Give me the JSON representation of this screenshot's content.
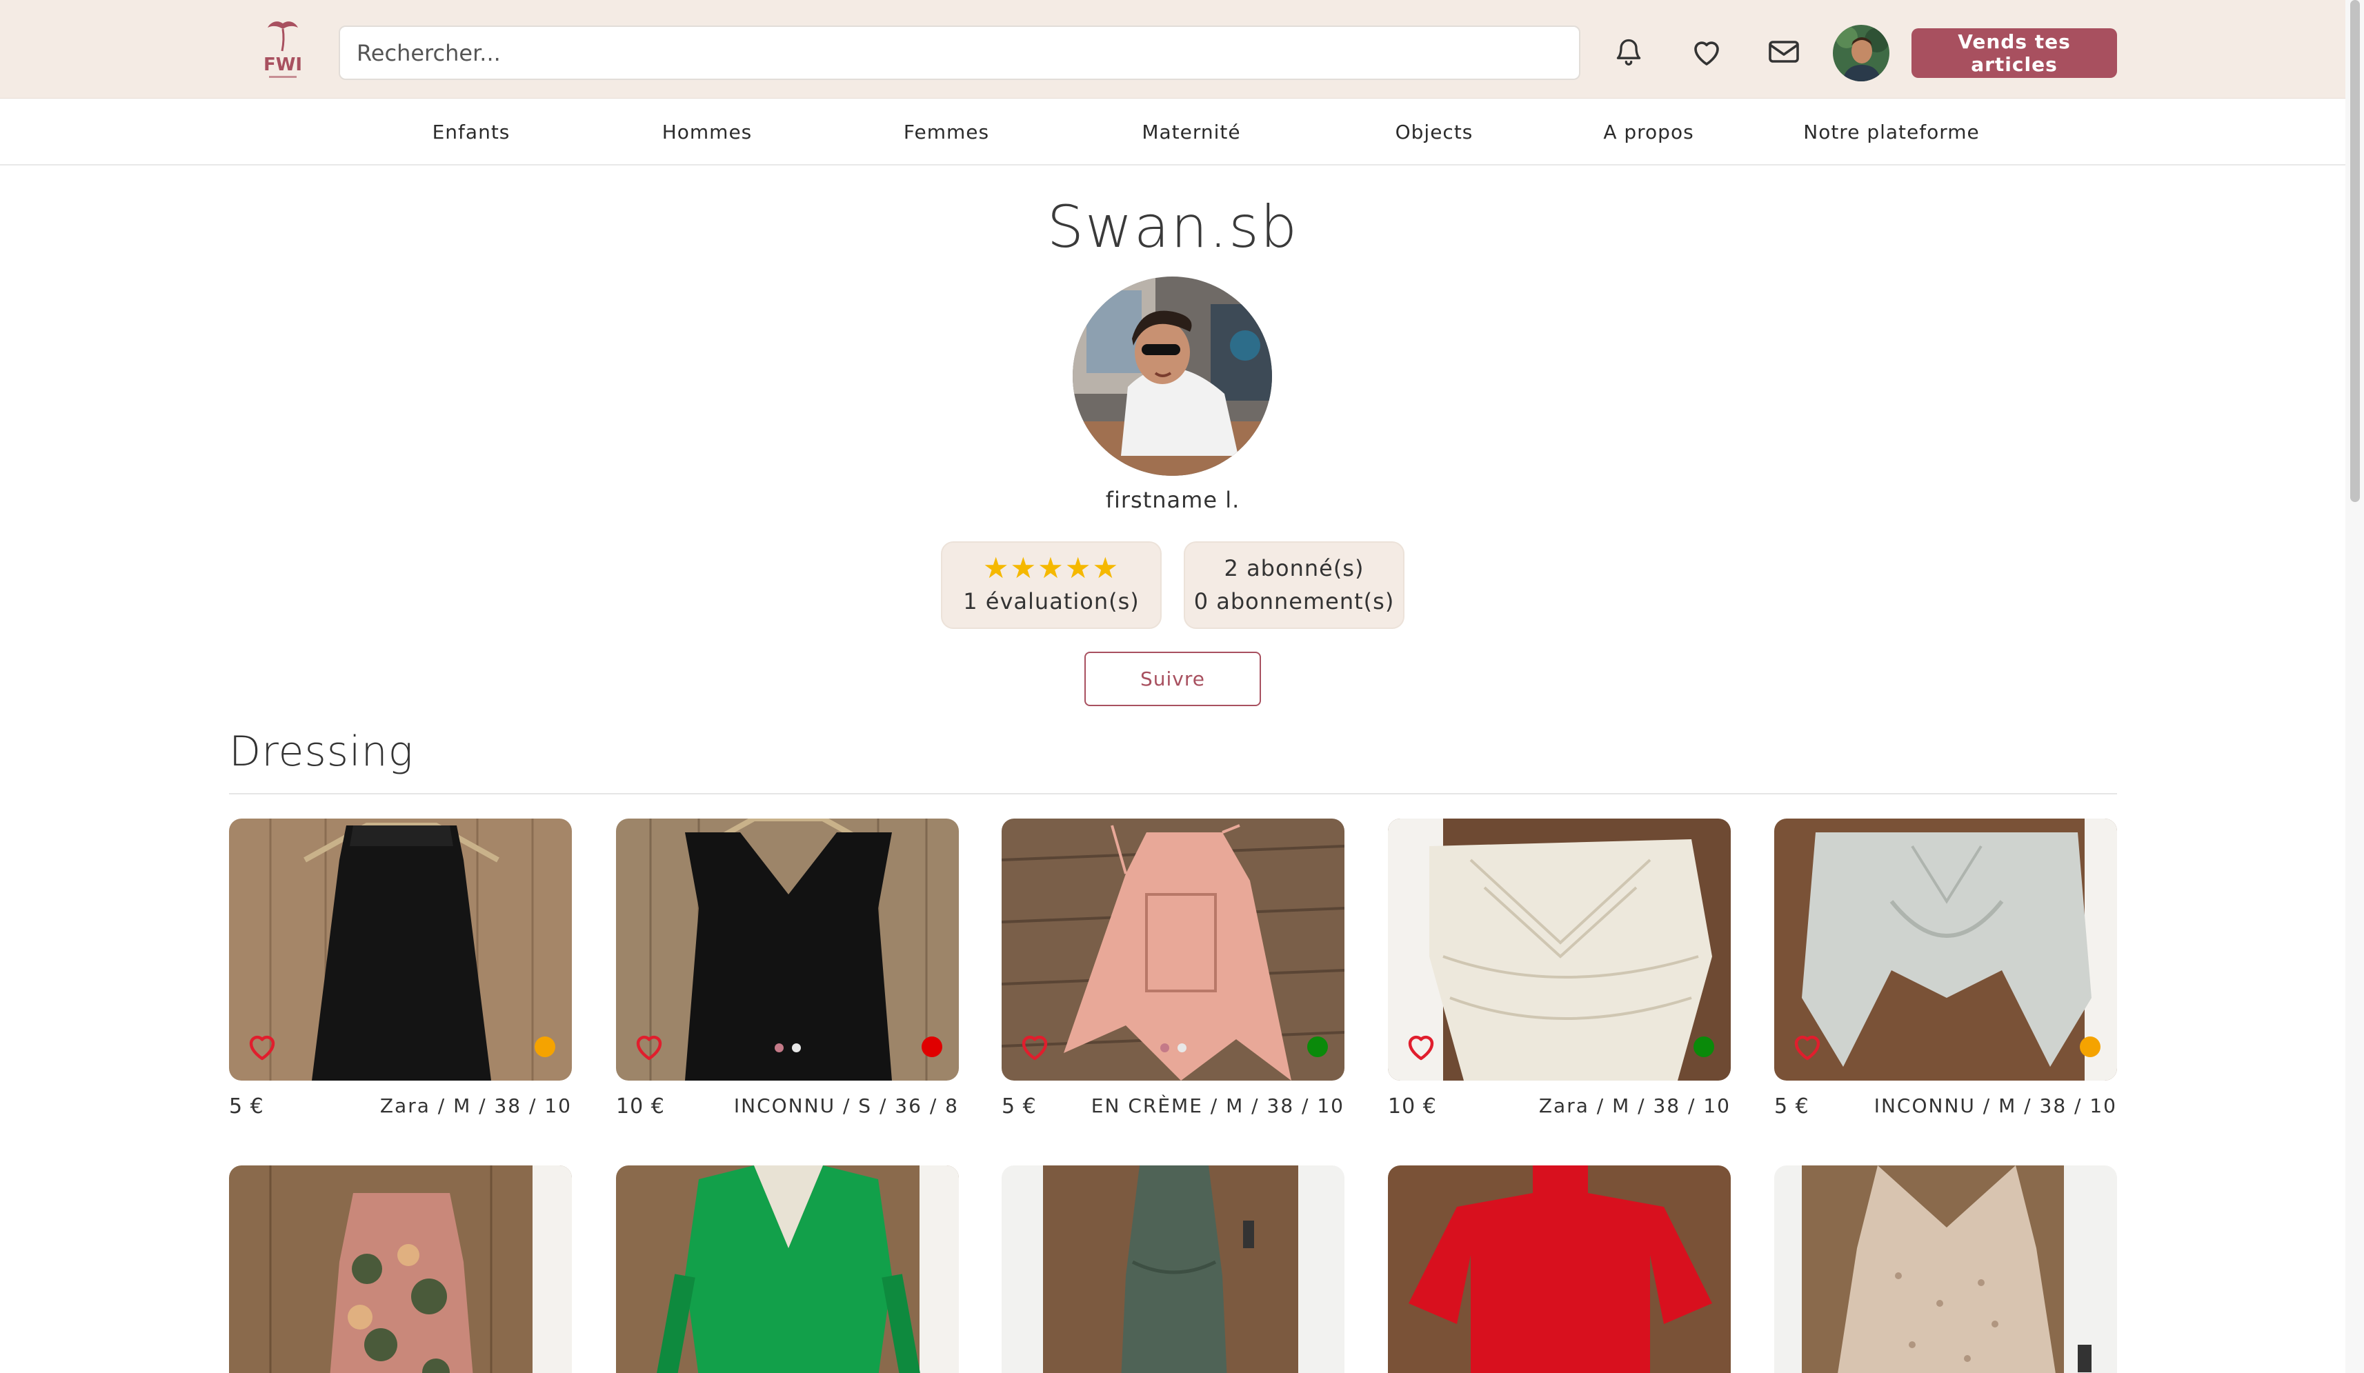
{
  "header": {
    "logo_text": "FWI",
    "search_placeholder": "Rechercher...",
    "sell_label": "Vends tes articles",
    "icons": [
      "bell-icon",
      "heart-icon",
      "mail-icon"
    ]
  },
  "nav": {
    "items": [
      "Enfants",
      "Hommes",
      "Femmes",
      "Maternité",
      "Objects",
      "A propos",
      "Notre plateforme"
    ]
  },
  "profile": {
    "username": "Swan.sb",
    "realname": "firstname l.",
    "rating_stars": 5,
    "stars_glyph": "★★★★★",
    "reviews_label": "1 évaluation(s)",
    "followers_label": "2 abonné(s)",
    "following_label": "0 abonnement(s)",
    "follow_label": "Suivre"
  },
  "dressing": {
    "title": "Dressing",
    "items": [
      {
        "price": "5 €",
        "meta": "Zara / M / 38 / 10",
        "status_color": "#f5a300",
        "pager": false,
        "garment": "black-dress"
      },
      {
        "price": "10 €",
        "meta": "INCONNU / S / 36 / 8",
        "status_color": "#e00000",
        "pager": true,
        "garment": "black-top"
      },
      {
        "price": "5 €",
        "meta": "EN CRÈME / M / 38 / 10",
        "status_color": "#0a8a0a",
        "pager": true,
        "garment": "pink-top"
      },
      {
        "price": "10 €",
        "meta": "Zara / M / 38 / 10",
        "status_color": "#0a8a0a",
        "pager": false,
        "garment": "lace-top"
      },
      {
        "price": "5 €",
        "meta": "INCONNU / M / 38 / 10",
        "status_color": "#f5a300",
        "pager": false,
        "garment": "grey-top"
      },
      {
        "garment": "floral-dress"
      },
      {
        "garment": "green-dress"
      },
      {
        "garment": "khaki-dress"
      },
      {
        "garment": "red-top"
      },
      {
        "garment": "beige-dress"
      }
    ]
  },
  "colors": {
    "accent": "#a8505f",
    "header_bg": "#f4ebe4",
    "heart": "#e01e2d"
  }
}
